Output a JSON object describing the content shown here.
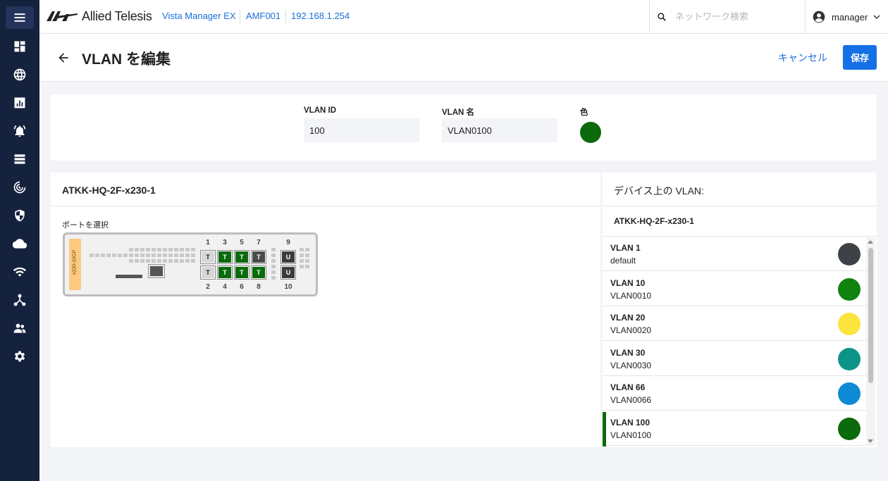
{
  "header": {
    "brand": "Allied Telesis",
    "breadcrumbs": [
      "Vista Manager EX",
      "AMF001",
      "192.168.1.254"
    ],
    "search_placeholder": "ネットワーク検索",
    "user": "manager"
  },
  "sidebar": {
    "items": [
      "menu-icon",
      "dashboard-icon",
      "globe-icon",
      "chart-icon",
      "alarm-icon",
      "list-icon",
      "radar-icon",
      "shield-icon",
      "cloud-icon",
      "wifi-icon",
      "topology-icon",
      "users-icon",
      "gear-icon"
    ]
  },
  "page": {
    "title": "VLAN を編集",
    "cancel": "キャンセル",
    "save": "保存"
  },
  "form": {
    "vlan_id_label": "VLAN ID",
    "vlan_id": "100",
    "vlan_name_label": "VLAN 名",
    "vlan_name": "VLAN0100",
    "color_label": "色",
    "color": "#0b6a0b"
  },
  "device": {
    "name": "ATKK-HQ-2F-x230-1",
    "select_port_label": "ポートを選択",
    "model": "x230-10GP",
    "ports_top": [
      {
        "num": "1",
        "mode": "T",
        "style": "none"
      },
      {
        "num": "3",
        "mode": "T",
        "style": "green"
      },
      {
        "num": "5",
        "mode": "T",
        "style": "green"
      },
      {
        "num": "7",
        "mode": "T",
        "style": "gray"
      },
      {
        "num": "9",
        "mode": "U",
        "style": "up"
      }
    ],
    "ports_bottom": [
      {
        "num": "2",
        "mode": "T",
        "style": "none"
      },
      {
        "num": "4",
        "mode": "T",
        "style": "green"
      },
      {
        "num": "6",
        "mode": "T",
        "style": "green"
      },
      {
        "num": "8",
        "mode": "T",
        "style": "green"
      },
      {
        "num": "10",
        "mode": "U",
        "style": "up"
      }
    ]
  },
  "vlan_list": {
    "title": "デバイス上の VLAN:",
    "device": "ATKK-HQ-2F-x230-1",
    "items": [
      {
        "name": "VLAN 1",
        "sub": "default",
        "color": "#3e4246",
        "selected": false
      },
      {
        "name": "VLAN 10",
        "sub": "VLAN0010",
        "color": "#0f820f",
        "selected": false
      },
      {
        "name": "VLAN 20",
        "sub": "VLAN0020",
        "color": "#fbe43c",
        "selected": false
      },
      {
        "name": "VLAN 30",
        "sub": "VLAN0030",
        "color": "#0d9488",
        "selected": false
      },
      {
        "name": "VLAN 66",
        "sub": "VLAN0066",
        "color": "#0f8ad4",
        "selected": false
      },
      {
        "name": "VLAN 100",
        "sub": "VLAN0100",
        "color": "#0b6a0b",
        "selected": true
      }
    ]
  }
}
